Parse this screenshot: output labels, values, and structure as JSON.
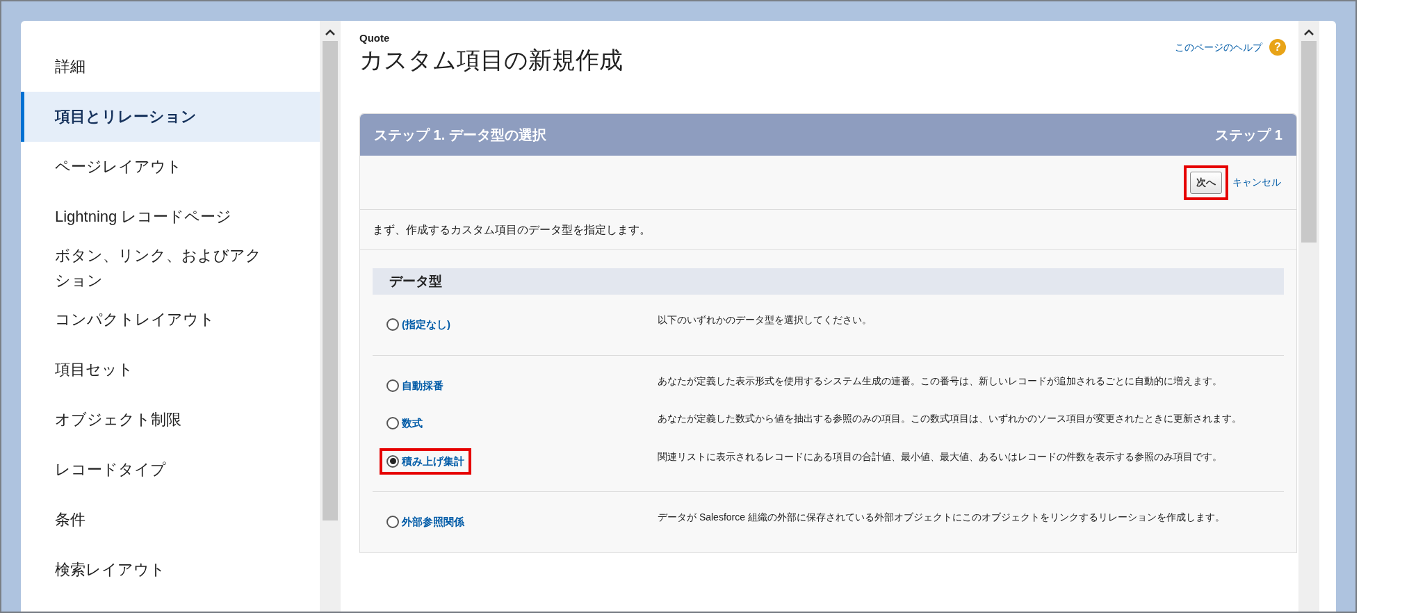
{
  "sidebar": {
    "items": [
      {
        "label": "詳細",
        "selected": false
      },
      {
        "label": "項目とリレーション",
        "selected": true
      },
      {
        "label": "ページレイアウト",
        "selected": false
      },
      {
        "label": "Lightning レコードページ",
        "selected": false
      },
      {
        "label": "ボタン、リンク、およびアクション",
        "selected": false
      },
      {
        "label": "コンパクトレイアウト",
        "selected": false
      },
      {
        "label": "項目セット",
        "selected": false
      },
      {
        "label": "オブジェクト制限",
        "selected": false
      },
      {
        "label": "レコードタイプ",
        "selected": false
      },
      {
        "label": "条件",
        "selected": false
      },
      {
        "label": "検索レイアウト",
        "selected": false
      }
    ]
  },
  "page": {
    "object": "Quote",
    "title": "カスタム項目の新規作成",
    "help_link": "このページのヘルプ",
    "help_icon": "?"
  },
  "step": {
    "heading": "ステップ 1. データ型の選択",
    "step_label": "ステップ 1",
    "next_button": {
      "label": "次へ",
      "highlighted": true
    },
    "cancel_link": "キャンセル",
    "instruction": "まず、作成するカスタム項目のデータ型を指定します。",
    "section_title": "データ型",
    "groups": [
      [
        {
          "label": "(指定なし)",
          "description": "以下のいずれかのデータ型を選択してください。",
          "selected": false,
          "highlighted": false
        }
      ],
      [
        {
          "label": "自動採番",
          "description": "あなたが定義した表示形式を使用するシステム生成の連番。この番号は、新しいレコードが追加されるごとに自動的に増えます。",
          "selected": false,
          "highlighted": false
        },
        {
          "label": "数式",
          "description": "あなたが定義した数式から値を抽出する参照のみの項目。この数式項目は、いずれかのソース項目が変更されたときに更新されます。",
          "selected": false,
          "highlighted": false
        },
        {
          "label": "積み上げ集計",
          "description": "関連リストに表示されるレコードにある項目の合計値、最小値、最大値、あるいはレコードの件数を表示する参照のみ項目です。",
          "selected": true,
          "highlighted": true
        }
      ],
      [
        {
          "label": "外部参照関係",
          "description": "データが Salesforce 組織の外部に保存されている外部オブジェクトにこのオブジェクトをリンクするリレーションを作成します。",
          "selected": false,
          "highlighted": false
        }
      ]
    ]
  }
}
